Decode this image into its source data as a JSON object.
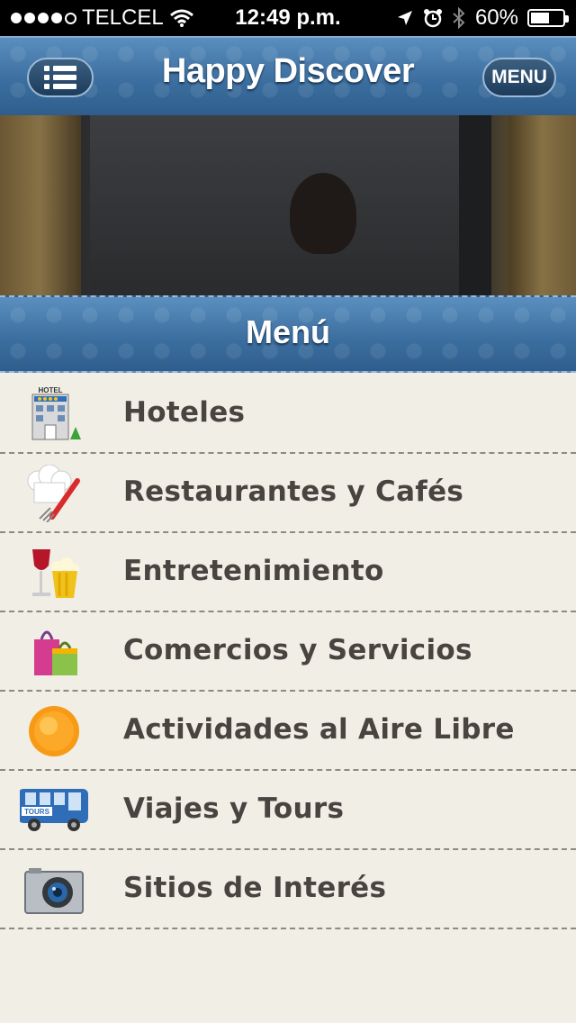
{
  "status_bar": {
    "carrier": "TELCEL",
    "time": "12:49 p.m.",
    "battery": "60%",
    "signal_dots_filled": 4,
    "signal_dots_total": 5,
    "battery_level": 0.6
  },
  "nav": {
    "title": "Happy Discover",
    "menu_button": "MENU",
    "list_button_icon": "list-icon"
  },
  "section": {
    "title": "Menú"
  },
  "menu": {
    "items": [
      {
        "label": "Hoteles",
        "icon": "hotel-icon"
      },
      {
        "label": "Restaurantes y Cafés",
        "icon": "chef-hat-icon"
      },
      {
        "label": "Entretenimiento",
        "icon": "wine-popcorn-icon"
      },
      {
        "label": "Comercios y Servicios",
        "icon": "shopping-bags-icon"
      },
      {
        "label": "Actividades al Aire Libre",
        "icon": "sun-icon"
      },
      {
        "label": "Viajes y Tours",
        "icon": "tour-bus-icon"
      },
      {
        "label": "Sitios de Interés",
        "icon": "camera-icon"
      }
    ]
  },
  "colors": {
    "nav_blue": "#3a6d9e",
    "text": "#4a4440",
    "background": "#f1eee6"
  },
  "hotel_sign": "HOTEL",
  "bus_sign": "TOURS"
}
